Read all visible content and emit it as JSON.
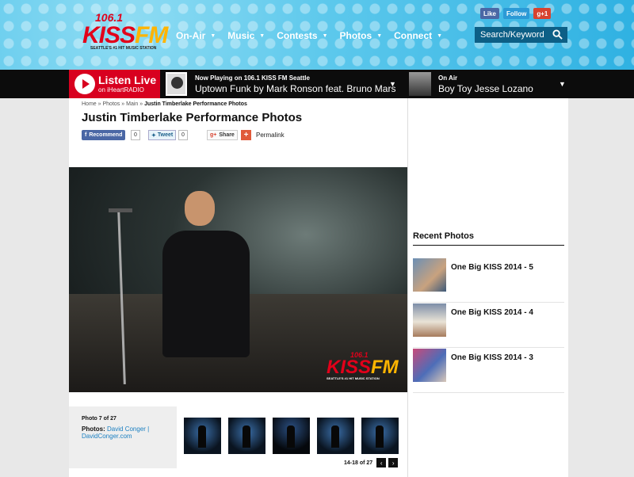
{
  "logo": {
    "number": "106.1",
    "brand_a": "KISS",
    "brand_b": "FM",
    "tagline": "SEATTLE'S #1 HIT MUSIC STATION"
  },
  "nav": [
    {
      "label": "On-Air"
    },
    {
      "label": "Music"
    },
    {
      "label": "Contests"
    },
    {
      "label": "Photos"
    },
    {
      "label": "Connect"
    }
  ],
  "social": {
    "like": "Like",
    "follow": "Follow",
    "gplus": "g+1"
  },
  "search": {
    "placeholder": "Search/Keyword"
  },
  "player": {
    "listen_live": "Listen Live",
    "on_iheart": "on iHeartRADIO",
    "now_playing_label": "Now Playing on 106.1 KISS FM Seattle",
    "now_playing_track": "Uptown Funk by Mark Ronson feat. Bruno Mars",
    "on_air_label": "On Air",
    "on_air_host": "Boy Toy Jesse Lozano"
  },
  "breadcrumb": {
    "home": "Home",
    "sep": "»",
    "photos": "Photos",
    "main": "Main",
    "current": "Justin Timberlake Performance Photos"
  },
  "page_title": "Justin Timberlake Performance Photos",
  "share": {
    "recommend": "Recommend",
    "recommend_count": "0",
    "tweet": "Tweet",
    "tweet_count": "0",
    "gshare": "Share",
    "permalink": "Permalink"
  },
  "caption": {
    "photo_counter": "Photo 7 of 27",
    "photos_label": "Photos:",
    "credit_1": "David Conger |",
    "credit_2": "DavidConger.com"
  },
  "pager": {
    "range": "14-18 of 27",
    "prev": "‹",
    "next": "›"
  },
  "recent": {
    "title": "Recent Photos",
    "items": [
      {
        "label": "One Big KISS 2014 - 5"
      },
      {
        "label": "One Big KISS 2014 - 4"
      },
      {
        "label": "One Big KISS 2014 - 3"
      }
    ]
  }
}
